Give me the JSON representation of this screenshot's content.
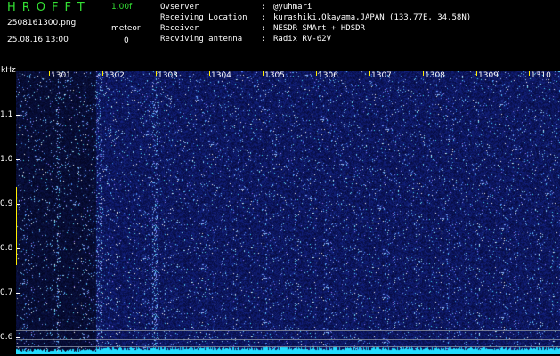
{
  "header": {
    "logo": "HROFFT",
    "version": "1.00f",
    "filename": "2508161300.png",
    "datetime": "25.08.16 13:00",
    "meteor_label": "meteor",
    "meteor_count": "0"
  },
  "station_info": [
    {
      "label": "Ovserver",
      "value": "@yuhmari"
    },
    {
      "label": "Receiving Location",
      "value": "kurashiki,Okayama,JAPAN (133.77E, 34.58N)"
    },
    {
      "label": "Receiver",
      "value": "NESDR SMArt + HDSDR"
    },
    {
      "label": "Recviving antenna",
      "value": "Radix RV-62V"
    }
  ],
  "axes": {
    "y_unit": "kHz",
    "y_ticks": [
      "1.1",
      "1.0",
      "0.9",
      "0.8",
      "0.7",
      "0.6"
    ],
    "x_ticks": [
      "1301",
      "1302",
      "1303",
      "1304",
      "1305",
      "1306",
      "1307",
      "1308",
      "1309",
      "1310"
    ]
  },
  "colors": {
    "background": "#000000",
    "waterfall_base": "#0a0a6e",
    "noise": "#3a4cff",
    "trace": "#22ddff",
    "label_green": "#33e033",
    "tick_yellow": "#ffee00"
  }
}
